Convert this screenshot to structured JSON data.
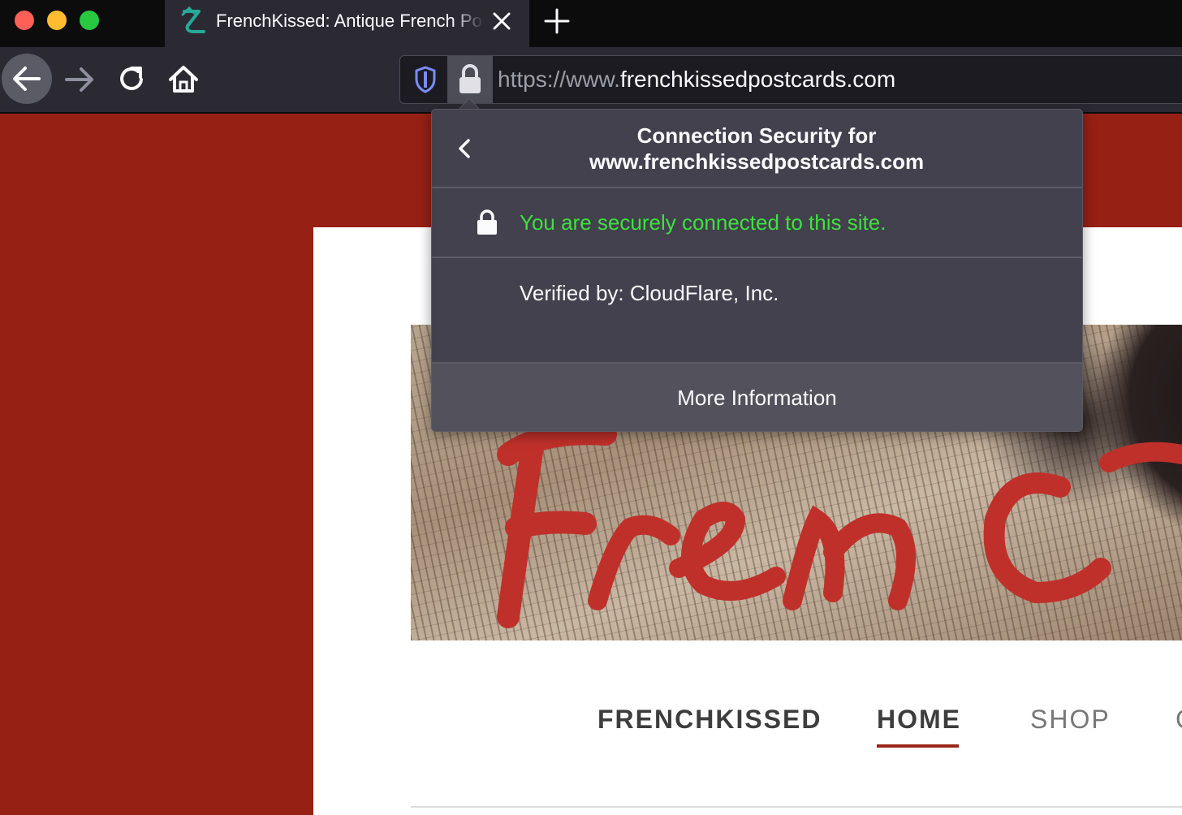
{
  "window": {
    "tab": {
      "title": "FrenchKissed: Antique French Postcards"
    },
    "url": {
      "scheme": "https://www.",
      "host": "frenchkissedpostcards.com"
    }
  },
  "icons": {
    "favicon": "site-favicon-icon",
    "tab_close": "close-icon",
    "new_tab": "plus-icon",
    "back": "arrow-left-icon",
    "forward": "arrow-right-icon",
    "reload": "reload-icon",
    "home": "home-icon",
    "tracking_protection": "shield-icon",
    "site_security": "lock-icon",
    "popup_back": "chevron-left-icon"
  },
  "popup": {
    "title_line1": "Connection Security for",
    "title_line2": "www.frenchkissedpostcards.com",
    "secure_message": "You are securely connected to this site.",
    "verified_by": "Verified by: CloudFlare, Inc.",
    "more_information": "More Information"
  },
  "site": {
    "nav": {
      "brand": "FRENCHKISSED",
      "home": "HOME",
      "shop": "SHOP",
      "next": "C"
    }
  },
  "colors": {
    "page_background": "#962013",
    "secure_text": "#3fe03f",
    "active_underline": "#9a2519",
    "popup_background": "#42414d"
  }
}
